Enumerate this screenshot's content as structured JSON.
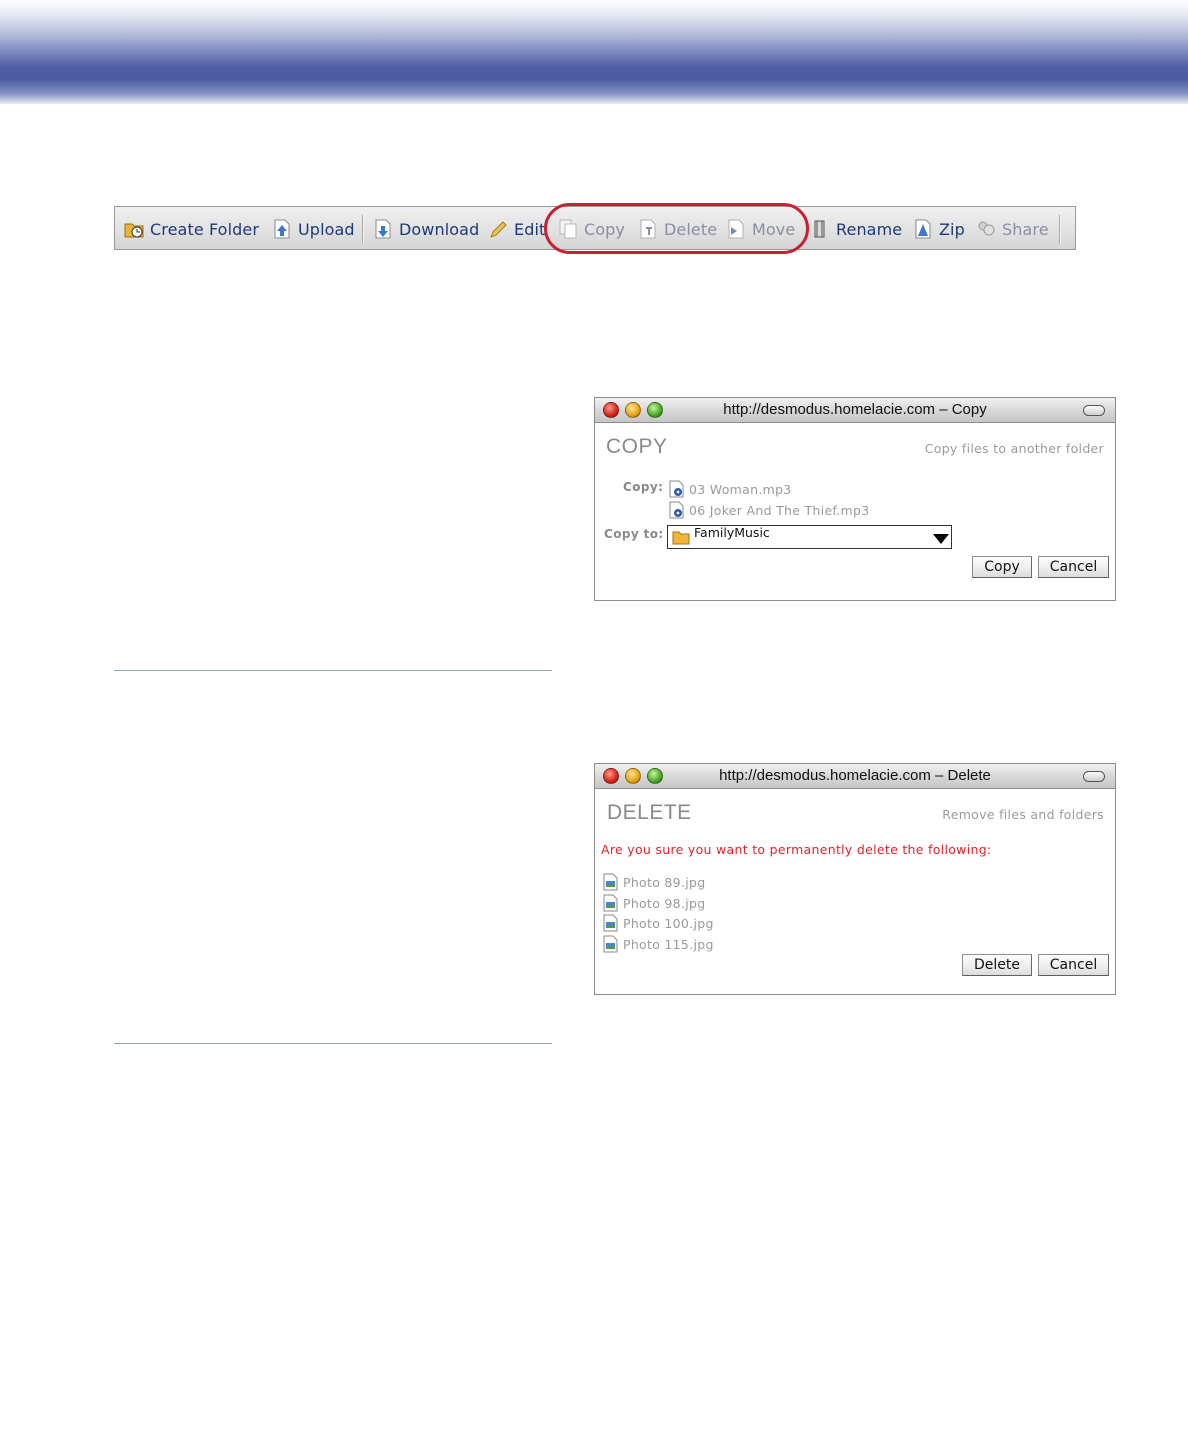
{
  "toolbar": {
    "items": [
      {
        "label": "Create Folder",
        "icon": "create-folder-icon"
      },
      {
        "label": "Upload",
        "icon": "upload-icon"
      },
      {
        "label": "Download",
        "icon": "download-icon"
      },
      {
        "label": "Edit",
        "icon": "pencil-icon"
      },
      {
        "label": "Copy",
        "icon": "copy-icon"
      },
      {
        "label": "Delete",
        "icon": "delete-icon"
      },
      {
        "label": "Move",
        "icon": "move-icon"
      },
      {
        "label": "Rename",
        "icon": "rename-icon"
      },
      {
        "label": "Zip",
        "icon": "zip-icon"
      },
      {
        "label": "Share",
        "icon": "share-icon"
      }
    ],
    "highlight_color": "#c8202e"
  },
  "copy_dialog": {
    "window_title": "http://desmodus.homelacie.com – Copy",
    "heading": "COPY",
    "subtitle": "Copy files to another folder",
    "copy_label": "Copy:",
    "files": [
      "03 Woman.mp3",
      "06 Joker And The Thief.mp3"
    ],
    "copy_to_label": "Copy to:",
    "destination": "FamilyMusic",
    "buttons": {
      "confirm": "Copy",
      "cancel": "Cancel"
    }
  },
  "delete_dialog": {
    "window_title": "http://desmodus.homelacie.com – Delete",
    "heading": "DELETE",
    "subtitle": "Remove files and folders",
    "warning": "Are you sure you want to permanently delete the following:",
    "files": [
      "Photo 89.jpg",
      "Photo 98.jpg",
      "Photo 100.jpg",
      "Photo 115.jpg"
    ],
    "buttons": {
      "confirm": "Delete",
      "cancel": "Cancel"
    }
  },
  "colors": {
    "header_band": "#4a5aa0",
    "toolbar_text": "#1d3a78",
    "warning_text": "#e0242a",
    "divider": "#8fa6b8"
  }
}
